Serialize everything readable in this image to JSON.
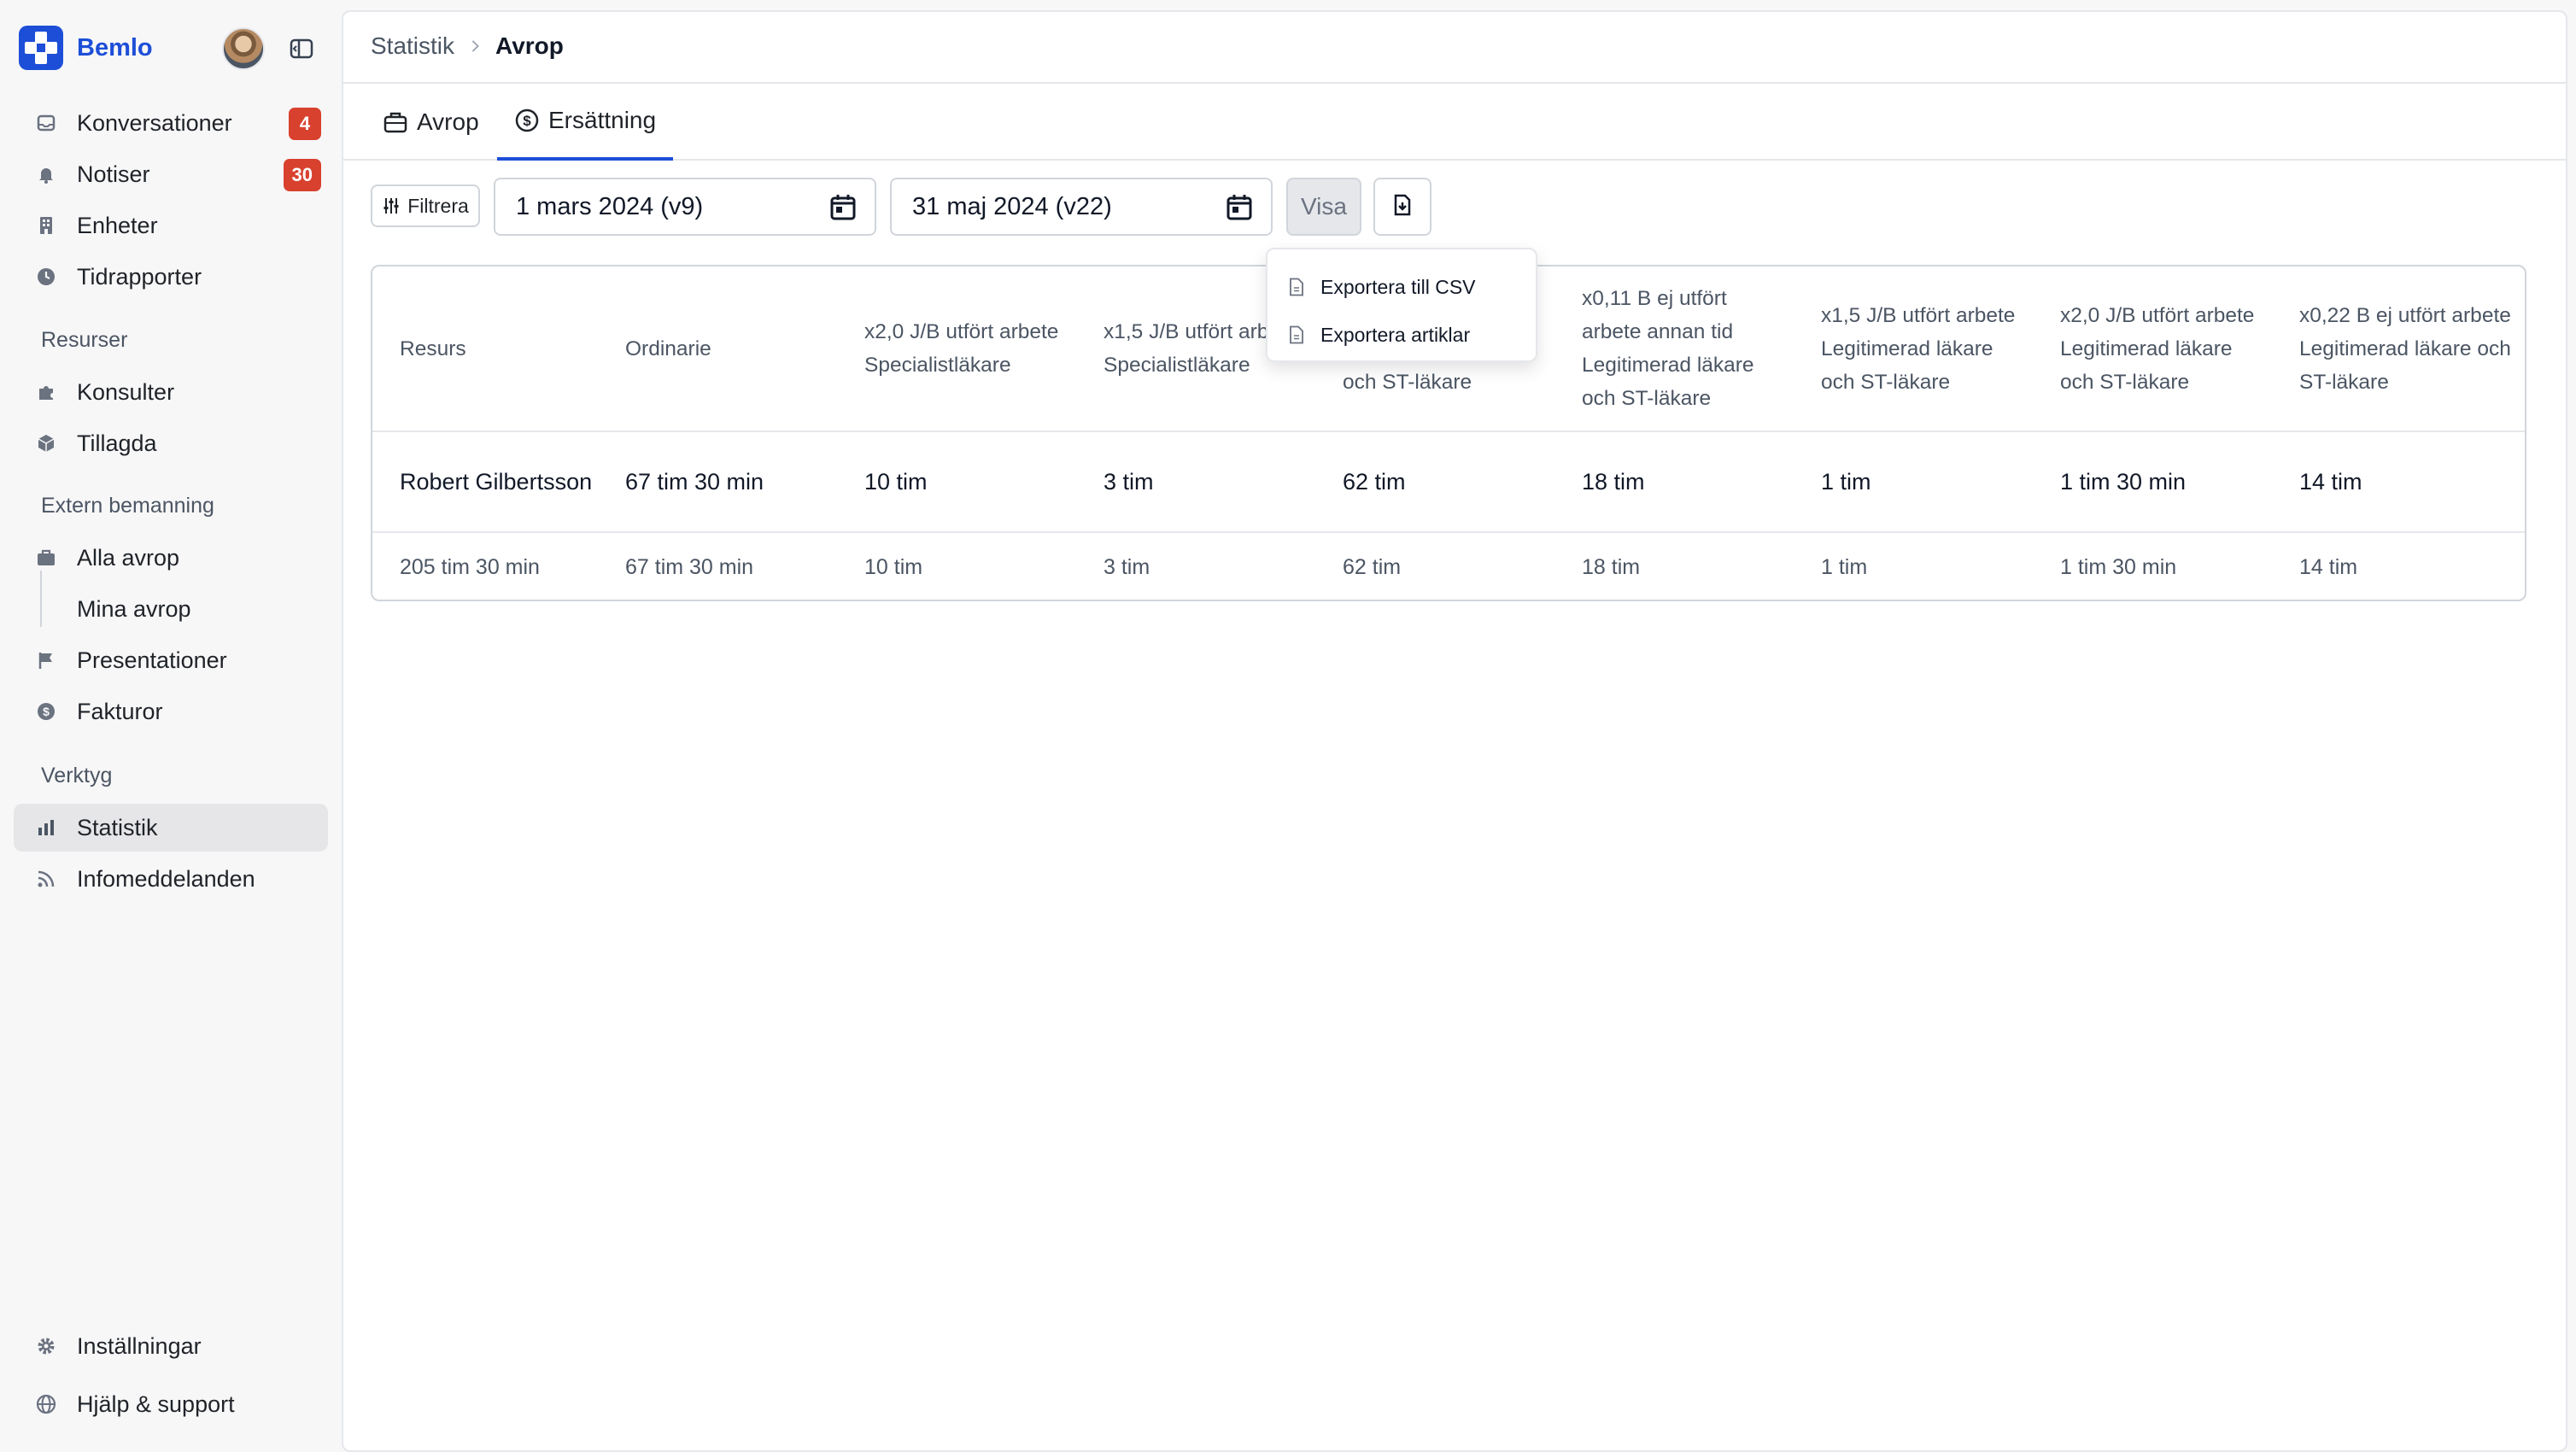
{
  "brand": {
    "name": "Bemlo",
    "color": "#1d4ed8"
  },
  "sidebar": {
    "items": [
      {
        "label": "Konversationer",
        "badge": "4",
        "icon": "inbox-icon"
      },
      {
        "label": "Notiser",
        "badge": "30",
        "icon": "bell-icon"
      },
      {
        "label": "Enheter",
        "icon": "building-icon"
      },
      {
        "label": "Tidrapporter",
        "icon": "clock-icon"
      }
    ],
    "sections": {
      "resurser": "Resurser",
      "extern": "Extern bemanning",
      "verktyg": "Verktyg"
    },
    "resurser_items": [
      {
        "label": "Konsulter",
        "icon": "puzzle-icon"
      },
      {
        "label": "Tillagda",
        "icon": "cube-icon"
      }
    ],
    "extern_items": [
      {
        "label": "Alla avrop",
        "icon": "briefcase-icon"
      },
      {
        "label": "Mina avrop"
      },
      {
        "label": "Presentationer",
        "icon": "flag-icon"
      },
      {
        "label": "Fakturor",
        "icon": "dollar-icon"
      }
    ],
    "verktyg_items": [
      {
        "label": "Statistik",
        "icon": "bar-chart-icon",
        "active": true
      },
      {
        "label": "Infomeddelanden",
        "icon": "rss-icon"
      }
    ],
    "bottom_items": [
      {
        "label": "Inställningar",
        "icon": "gear-icon"
      },
      {
        "label": "Hjälp & support",
        "icon": "globe-icon"
      }
    ],
    "badge_color": "#d9412f"
  },
  "breadcrumb": {
    "parent": "Statistik",
    "current": "Avrop"
  },
  "tabs": [
    {
      "label": "Avrop",
      "icon": "briefcase-icon"
    },
    {
      "label": "Ersättning",
      "icon": "dollar-circle-icon",
      "active": true
    }
  ],
  "toolbar": {
    "filter_label": "Filtrera",
    "start_date": "1 mars 2024 (v9)",
    "end_date": "31 maj 2024 (v22)",
    "visa_label": "Visa"
  },
  "export_menu": {
    "items": [
      "Exportera till CSV",
      "Exportera artiklar"
    ]
  },
  "table": {
    "headers": [
      "Resurs",
      "Ordinarie",
      "x2,0 J/B utfört arbete Specialistläkare",
      "x1,5 J/B utfört arbete Specialistläkare",
      "x1,0 J/B utfört arbete Legitimerad läkare och ST-läkare",
      "x0,11 B ej utfört arbete annan tid Legitimerad läkare och ST-läkare",
      "x1,5 J/B utfört arbete Legitimerad läkare och ST-läkare",
      "x2,0 J/B utfört arbete Legitimerad läkare och ST-läkare",
      "x0,22 B ej utfört arbete Legitimerad läkare och ST-läkare"
    ],
    "rows": [
      [
        "Robert Gilbertsson",
        "67 tim 30 min",
        "10 tim",
        "3 tim",
        "62 tim",
        "18 tim",
        "1 tim",
        "1 tim 30 min",
        "14 tim"
      ]
    ],
    "totals": [
      "205 tim 30 min",
      "67 tim 30 min",
      "10 tim",
      "3 tim",
      "62 tim",
      "18 tim",
      "1 tim",
      "1 tim 30 min",
      "14 tim"
    ]
  }
}
